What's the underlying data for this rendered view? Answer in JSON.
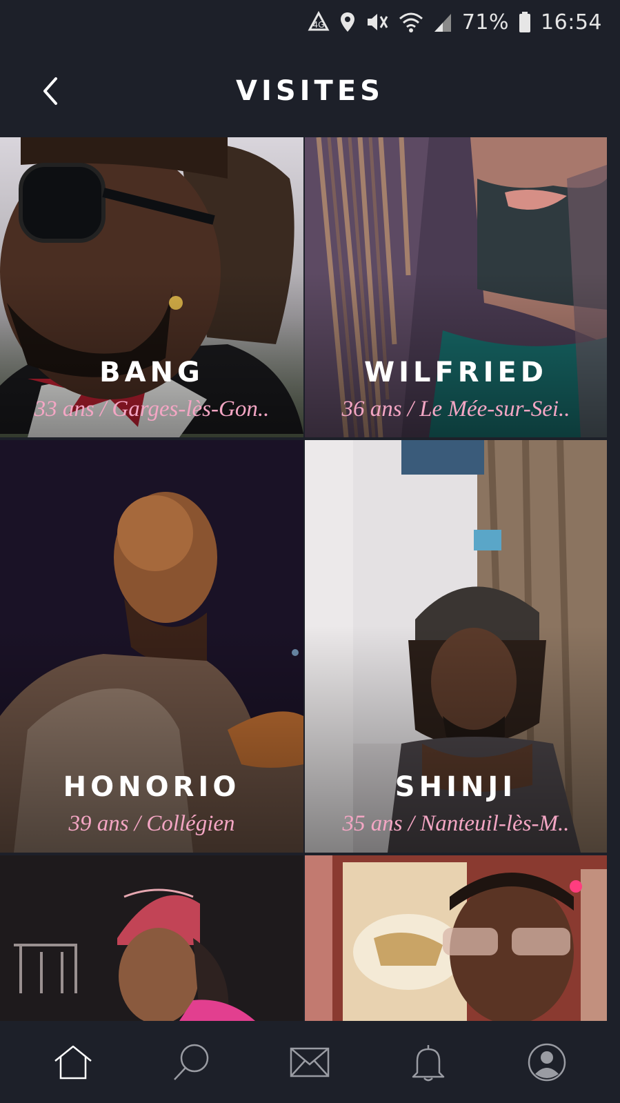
{
  "status_bar": {
    "battery_percent": "71%",
    "time": "16:54",
    "icons": [
      "data-saver-icon",
      "location-icon",
      "vibrate-mute-icon",
      "wifi-icon",
      "signal-icon",
      "battery-icon"
    ]
  },
  "header": {
    "title": "VISITES",
    "back_icon": "chevron-left-icon"
  },
  "profiles": [
    {
      "name": "BANG",
      "meta": "33 ans / Garges-lès-Gon.."
    },
    {
      "name": "WILFRIED",
      "meta": "36 ans / Le Mée-sur-Sei.."
    },
    {
      "name": "HONORIO",
      "meta": "39 ans / Collégien"
    },
    {
      "name": "SHINJI",
      "meta": "35 ans / Nanteuil-lès-M.."
    },
    {
      "name": "",
      "meta": ""
    },
    {
      "name": "",
      "meta": ""
    }
  ],
  "bottom_nav": [
    {
      "icon": "home-icon",
      "active": true
    },
    {
      "icon": "search-icon",
      "active": false
    },
    {
      "icon": "mail-icon",
      "active": false
    },
    {
      "icon": "bell-icon",
      "active": false
    },
    {
      "icon": "profile-icon",
      "active": false
    }
  ],
  "colors": {
    "background": "#1d2029",
    "meta_text": "#f4a6c4",
    "online_dot": "#ff3d7f"
  }
}
